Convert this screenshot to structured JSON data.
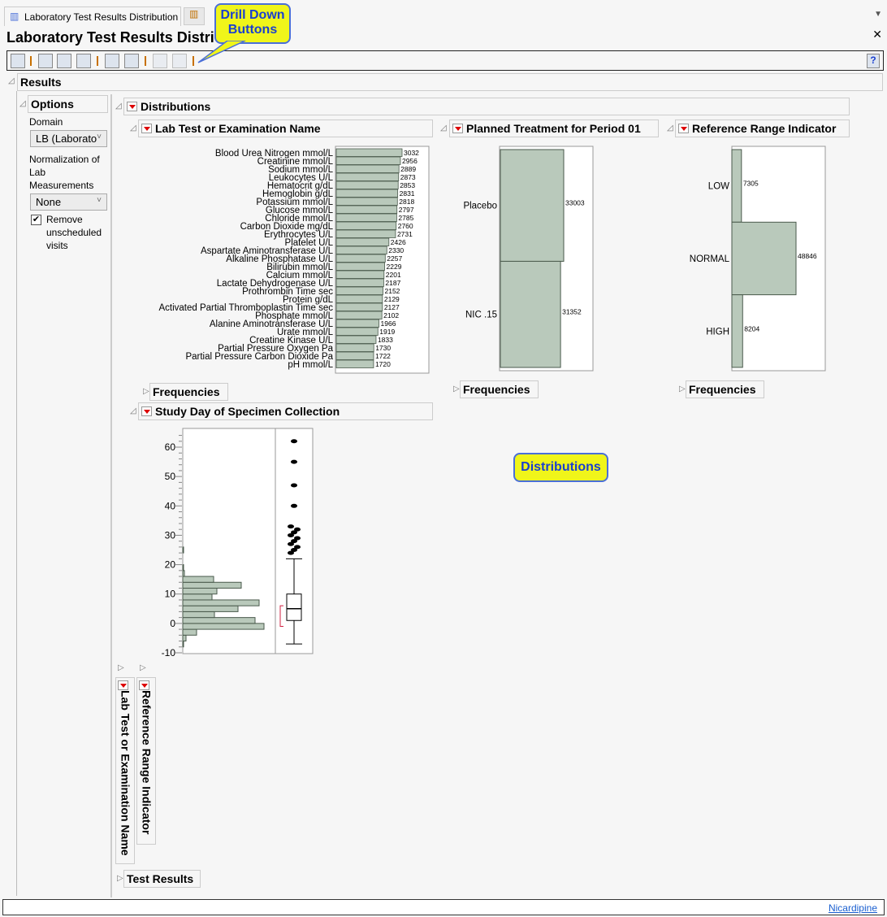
{
  "window": {
    "tab_label": "Laboratory Test Results Distribution",
    "title": "Laboratory Test Results Distribution",
    "title_visible": "Laboratory Test Results Distri",
    "footer_link": "Nicardipine"
  },
  "callouts": {
    "drill_down": "Drill Down Buttons",
    "distributions": "Distributions"
  },
  "results": {
    "label": "Results"
  },
  "options": {
    "label": "Options",
    "domain_label": "Domain",
    "domain_value": "LB (Laborato",
    "norm_label": "Normalization of Lab Measurements",
    "norm_value": "None",
    "remove_label": "Remove unscheduled visits",
    "remove_checked": true
  },
  "distributions": {
    "label": "Distributions",
    "frequencies": "Frequencies",
    "test_results": "Test Results",
    "vertical_headers": [
      "Lab Test or Examination Name",
      "Reference Range Indicator"
    ]
  },
  "chart_data": [
    {
      "type": "bar",
      "title": "Lab Test or Examination Name",
      "orientation": "horizontal",
      "categories": [
        "Blood Urea Nitrogen mmol/L",
        "Creatinine mmol/L",
        "Sodium mmol/L",
        "Leukocytes U/L",
        "Hematocrit g/dL",
        "Hemoglobin g/dL",
        "Potassium mmol/L",
        "Glucose mmol/L",
        "Chloride mmol/L",
        "Carbon Dioxide mg/dL",
        "Erythrocytes U/L",
        "Platelet U/L",
        "Aspartate Aminotransferase U/L",
        "Alkaline Phosphatase U/L",
        "Bilirubin mmol/L",
        "Calcium mmol/L",
        "Lactate Dehydrogenase U/L",
        "Prothrombin Time sec",
        "Protein g/dL",
        "Activated Partial Thromboplastin Time sec",
        "Phosphate mmol/L",
        "Alanine Aminotransferase U/L",
        "Urate mmol/L",
        "Creatine Kinase U/L",
        "Partial Pressure Oxygen Pa",
        "Partial Pressure Carbon Dioxide Pa",
        "pH mmol/L"
      ],
      "values": [
        3032,
        2956,
        2889,
        2873,
        2853,
        2831,
        2818,
        2797,
        2785,
        2760,
        2731,
        2426,
        2330,
        2257,
        2229,
        2201,
        2187,
        2152,
        2129,
        2127,
        2102,
        1966,
        1919,
        1833,
        1730,
        1722,
        1720
      ]
    },
    {
      "type": "bar",
      "title": "Planned Treatment for Period 01",
      "orientation": "horizontal",
      "categories": [
        "Placebo",
        "NIC .15"
      ],
      "values": [
        33003,
        31352
      ]
    },
    {
      "type": "bar",
      "title": "Reference Range Indicator",
      "orientation": "horizontal",
      "categories": [
        "LOW",
        "NORMAL",
        "HIGH"
      ],
      "values": [
        7305,
        48846,
        8204
      ]
    },
    {
      "type": "histogram",
      "title": "Study Day of Specimen Collection",
      "ylim": [
        -10,
        64
      ],
      "yticks": [
        "-10",
        "0",
        "10",
        "20",
        "30",
        "40",
        "50",
        "60"
      ],
      "bin_width": 2,
      "bins": [
        {
          "from": -8,
          "count": 1
        },
        {
          "from": -6,
          "count": 4
        },
        {
          "from": -4,
          "count": 17
        },
        {
          "from": -2,
          "count": 100
        },
        {
          "from": 0,
          "count": 89
        },
        {
          "from": 2,
          "count": 39
        },
        {
          "from": 4,
          "count": 68
        },
        {
          "from": 6,
          "count": 94
        },
        {
          "from": 8,
          "count": 36
        },
        {
          "from": 10,
          "count": 42
        },
        {
          "from": 12,
          "count": 72
        },
        {
          "from": 14,
          "count": 38
        },
        {
          "from": 16,
          "count": 2
        },
        {
          "from": 18,
          "count": 1
        },
        {
          "from": 24,
          "count": 1
        }
      ],
      "boxplot": {
        "min": -7,
        "q1": 1,
        "median": 5,
        "q3": 10,
        "max": 22,
        "shortest_half": [
          -1,
          6
        ],
        "outliers": [
          24,
          25,
          26,
          27,
          28,
          29,
          30,
          31,
          32,
          33,
          40,
          47,
          55,
          62
        ]
      }
    }
  ]
}
